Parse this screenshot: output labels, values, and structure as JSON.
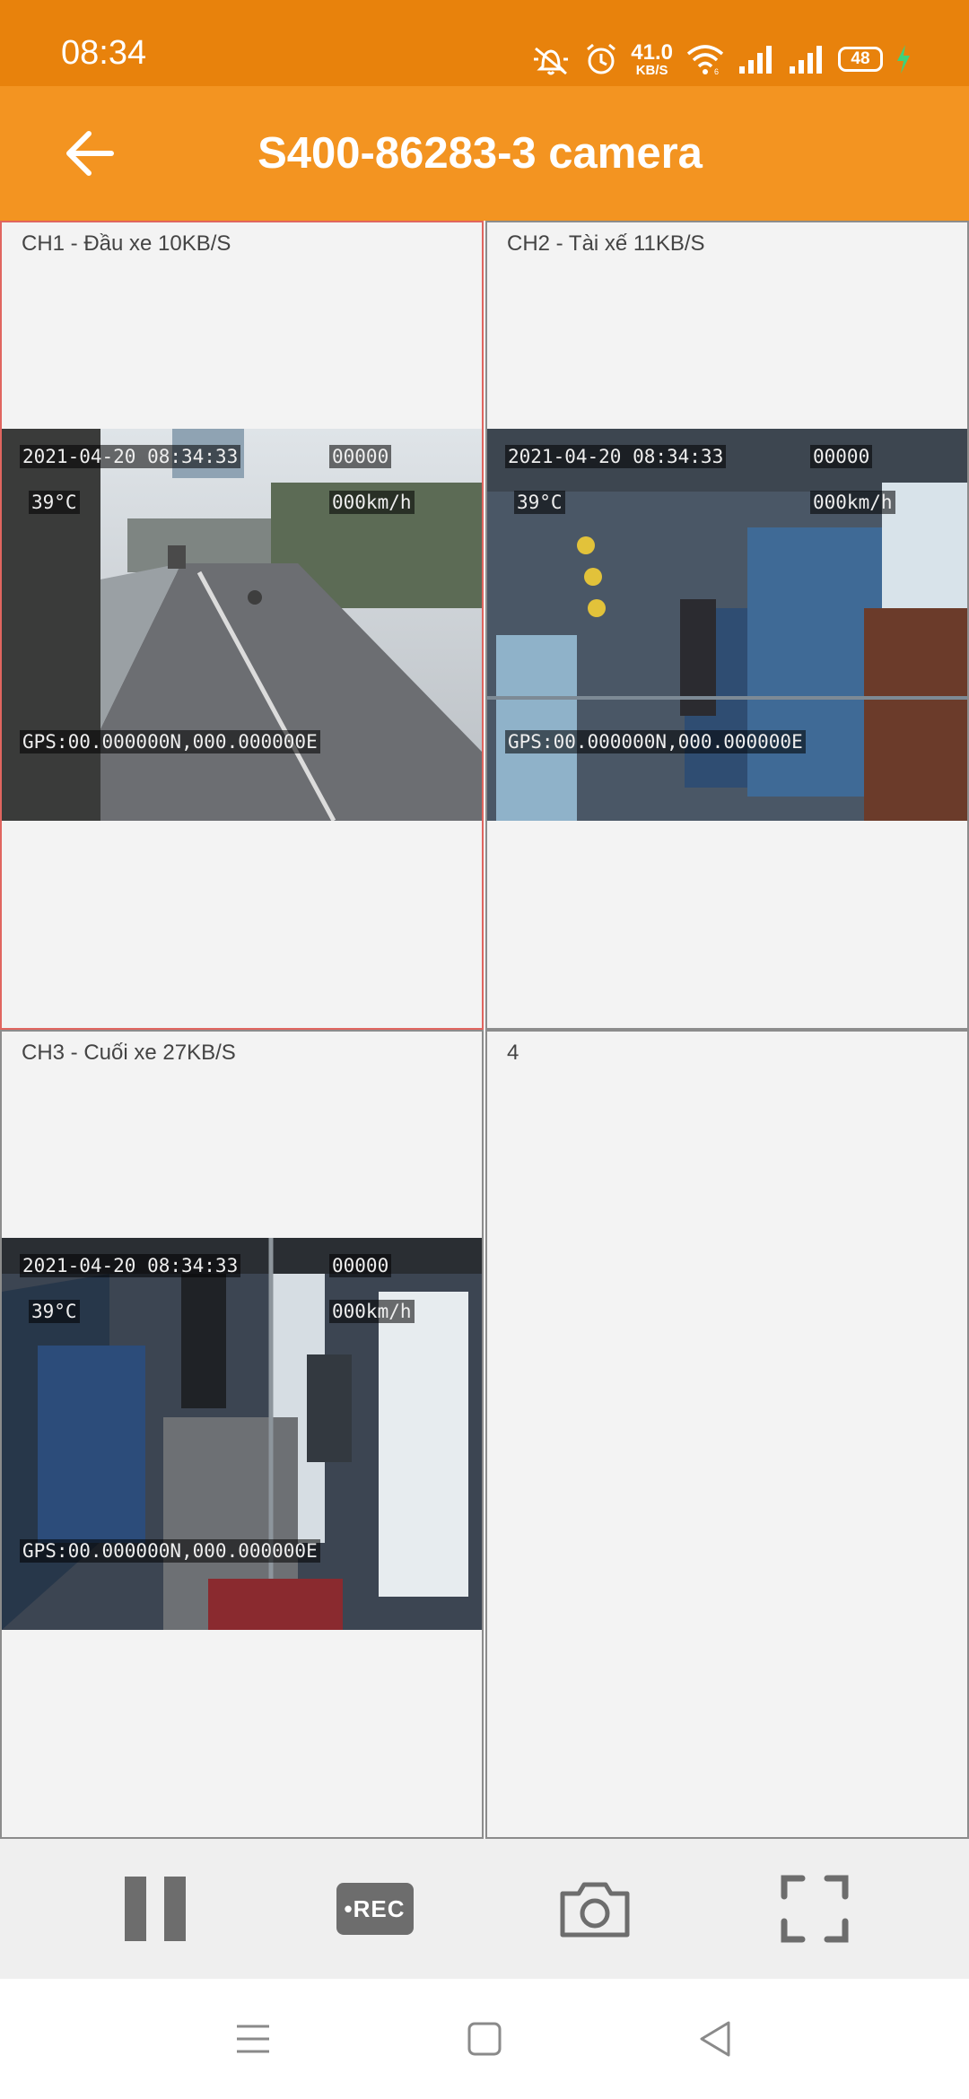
{
  "status_bar": {
    "time": "08:34",
    "net_speed_value": "41.0",
    "net_speed_unit": "KB/S",
    "battery": "48"
  },
  "app_bar": {
    "title": "S400-86283-3 camera"
  },
  "channels": [
    {
      "label": "CH1 - Đầu xe  10KB/S",
      "osd": {
        "datetime": "2021-04-20 08:34:33",
        "counter": "00000",
        "temp": "39°C",
        "speed": "000km/h",
        "gps": "GPS:00.000000N,000.000000E"
      }
    },
    {
      "label": "CH2 - Tài xế  11KB/S",
      "osd": {
        "datetime": "2021-04-20 08:34:33",
        "counter": "00000",
        "temp": "39°C",
        "speed": "000km/h",
        "gps": "GPS:00.000000N,000.000000E"
      }
    },
    {
      "label": "CH3 - Cuối xe  27KB/S",
      "osd": {
        "datetime": "2021-04-20 08:34:33",
        "counter": "00000",
        "temp": "39°C",
        "speed": "000km/h",
        "gps": "GPS:00.000000N,000.000000E"
      }
    },
    {
      "label": "4"
    }
  ],
  "toolbar": {
    "rec_label": "•REC"
  },
  "colors": {
    "status_bar": "#e8820c",
    "app_bar": "#f39421",
    "selected_border": "#e0655f",
    "icon_gray": "#6d6d6d"
  }
}
